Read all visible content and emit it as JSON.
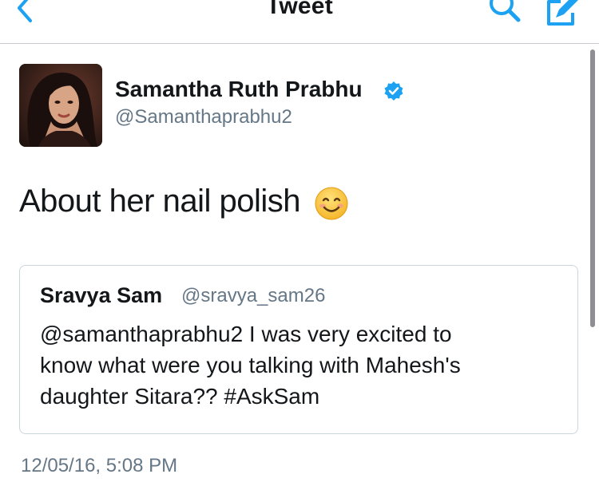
{
  "nav": {
    "title": "Tweet",
    "back_icon": "chevron-left-icon",
    "search_icon": "search-icon",
    "compose_icon": "compose-icon",
    "accent_color": "#1da1f2"
  },
  "tweet": {
    "author_name": "Samantha Ruth Prabhu",
    "author_handle": "@Samanthaprabhu2",
    "verified": true,
    "text": "About her nail polish",
    "emoji": "smiling-face-emoji",
    "timestamp": "12/05/16, 5:08 PM"
  },
  "quoted_tweet": {
    "author_name": "Sravya Sam",
    "author_handle": "@sravya_sam26",
    "text": "@samanthaprabhu2 I was very excited to\nknow what were you talking with Mahesh's\ndaughter Sitara??  #AskSam"
  },
  "colors": {
    "text_primary": "#14171a",
    "text_secondary": "#657786",
    "border": "#ccd6dd",
    "verified_blue": "#1da1f2"
  }
}
